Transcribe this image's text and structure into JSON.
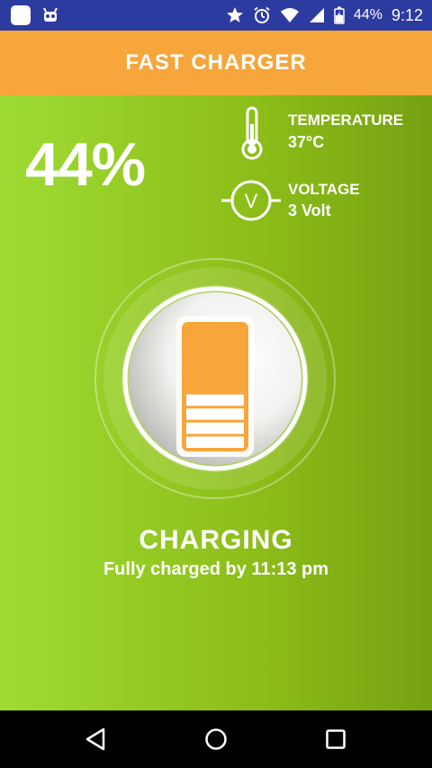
{
  "status_bar": {
    "battery_level": "44%",
    "time": "9:12",
    "left_icons": [
      "app-square-icon",
      "android-robot-icon"
    ],
    "right_icons": [
      "star-icon",
      "alarm-clock-icon",
      "wifi-icon",
      "signal-icon",
      "battery-icon"
    ]
  },
  "header": {
    "title": "FAST CHARGER"
  },
  "stats": {
    "percent": "44%",
    "temperature": {
      "label": "TEMPERATURE",
      "value": "37°C"
    },
    "voltage": {
      "label": "VOLTAGE",
      "value": "3 Volt",
      "icon_letter": "V"
    }
  },
  "charging": {
    "title": "CHARGING",
    "subtitle": "Fully charged by 11:13 pm",
    "battery_fill_level": 0.44
  },
  "nav": {
    "icons": [
      "back-icon",
      "home-icon",
      "recents-icon"
    ]
  },
  "colors": {
    "status_bar": "#2c3ba0",
    "header": "#f6a63b",
    "green_light": "#9fdb34",
    "green_dark": "#77a112",
    "battery_orange": "#f6a63b"
  }
}
